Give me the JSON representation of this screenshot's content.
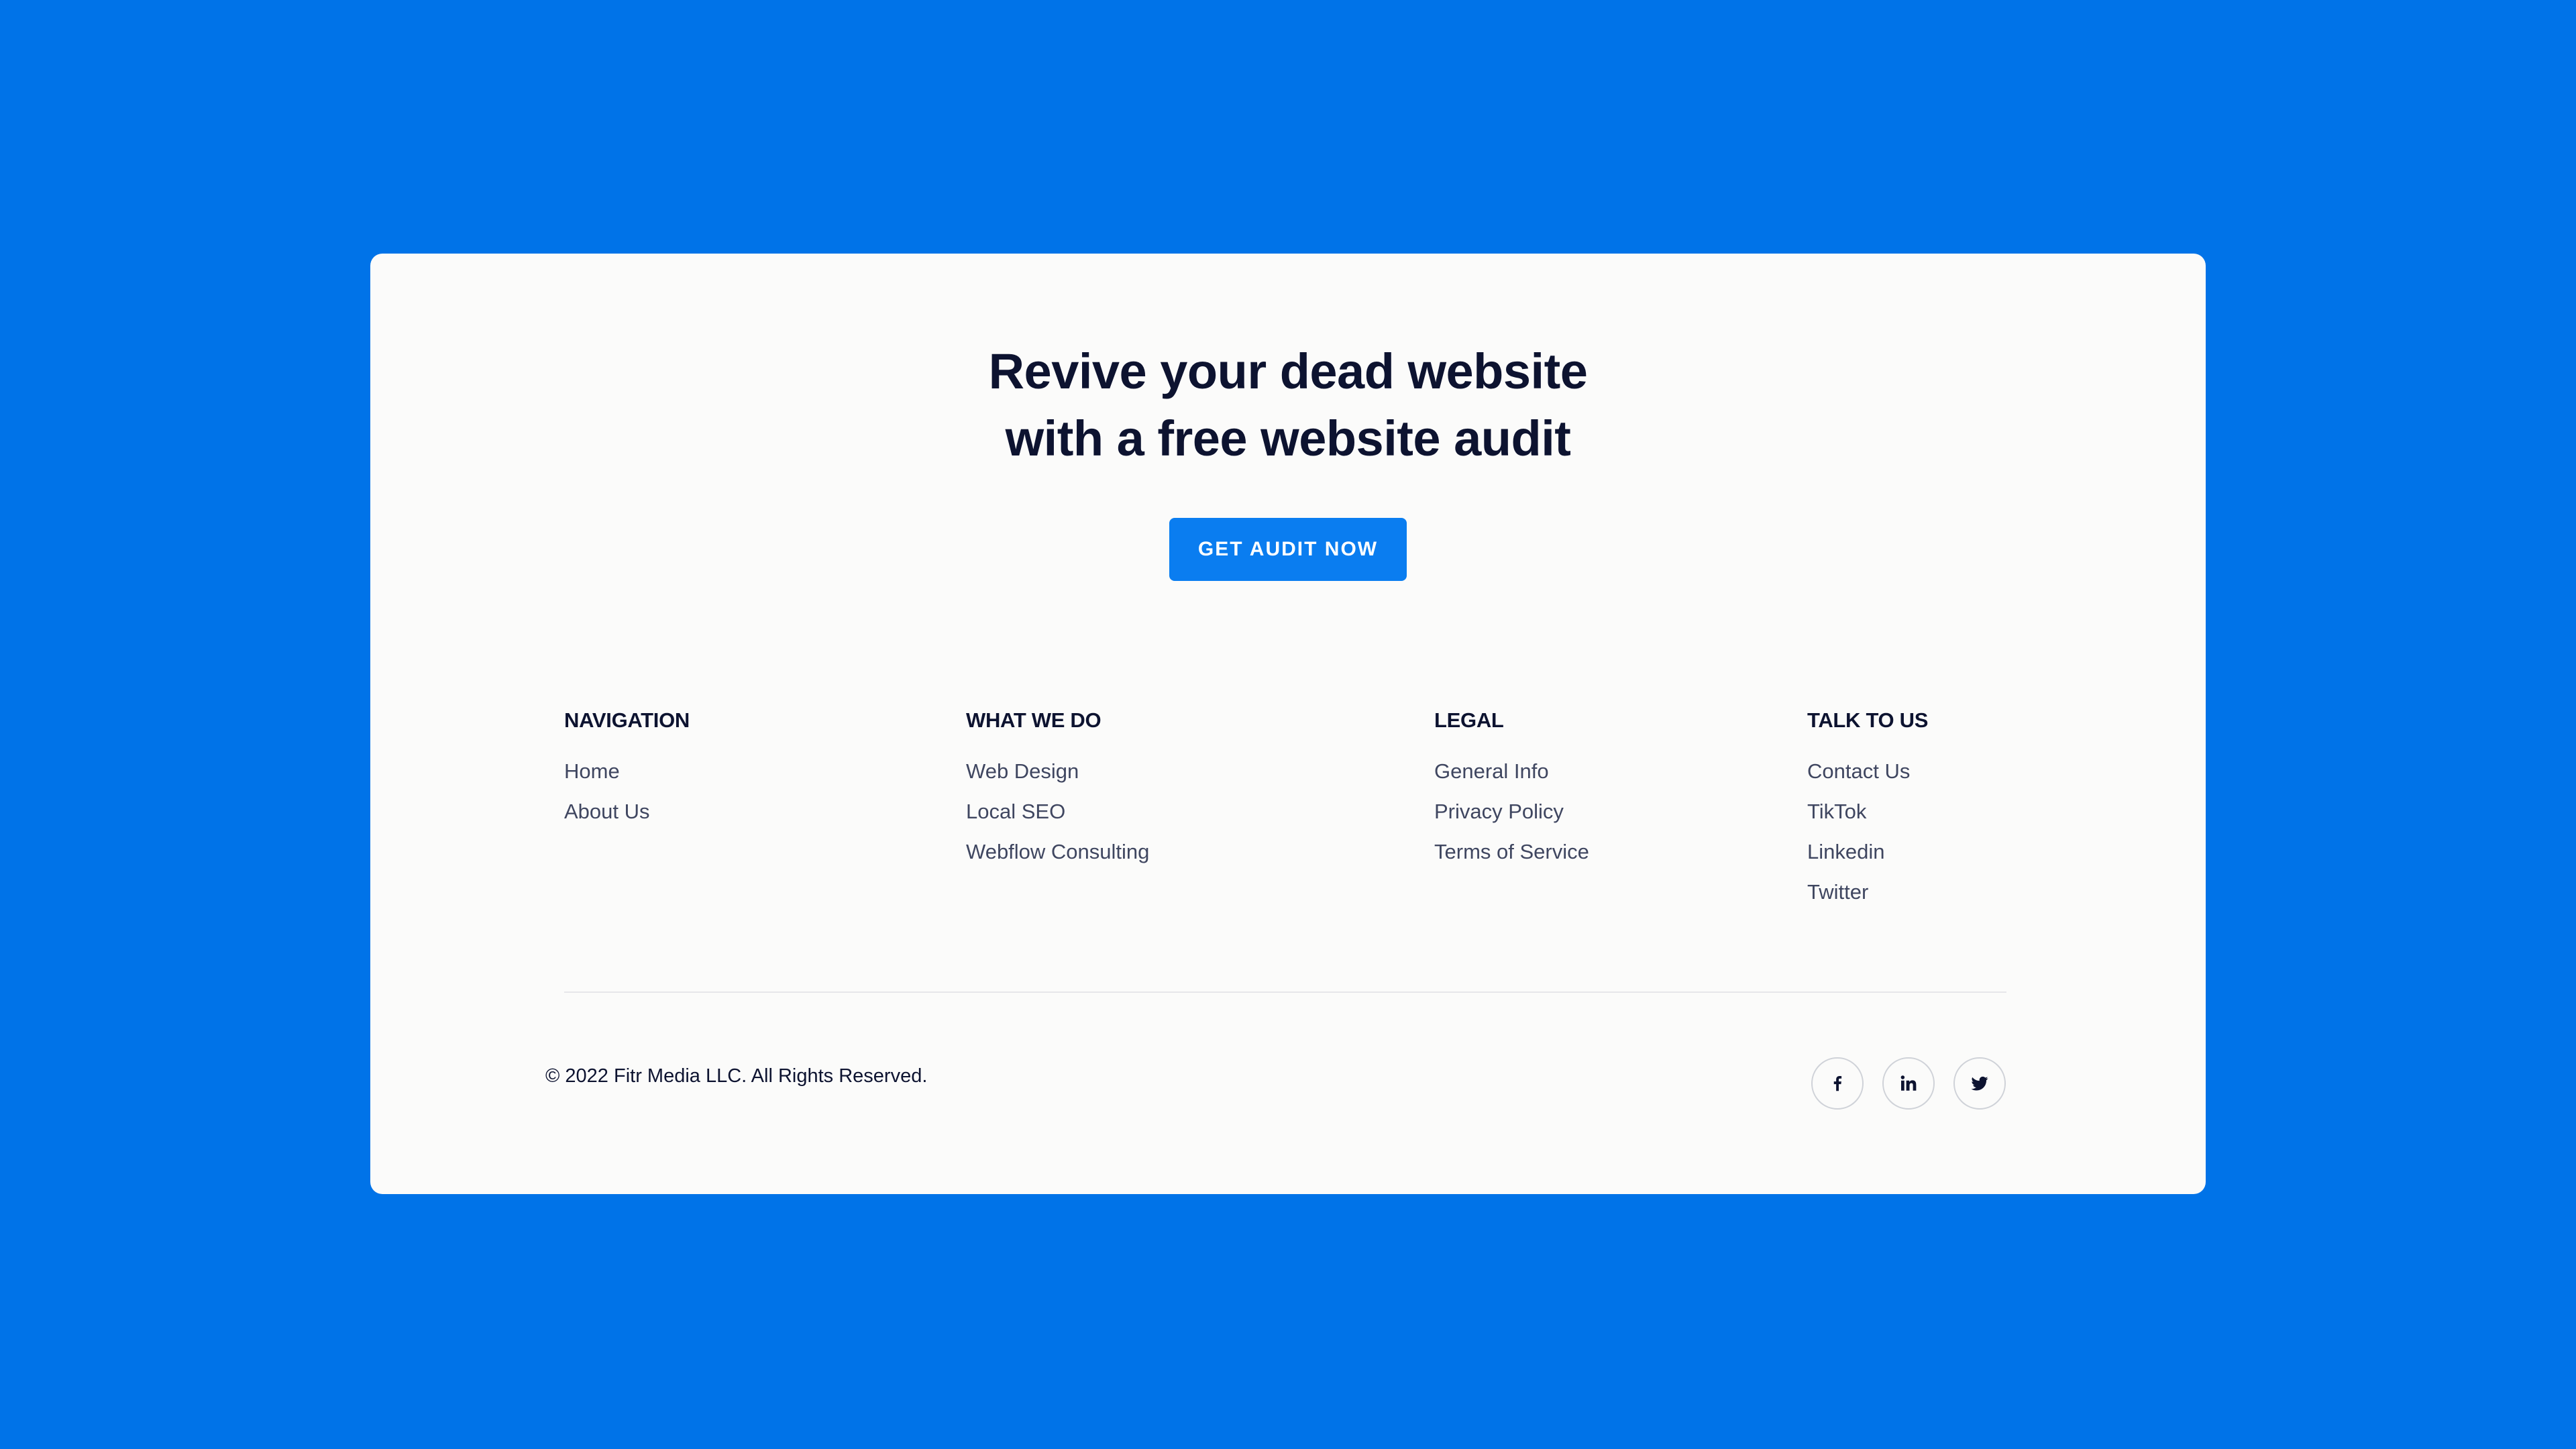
{
  "cta": {
    "heading_line1": "Revive your dead website",
    "heading_line2": "with a free website audit",
    "button_label": "GET AUDIT NOW"
  },
  "footer": {
    "columns": [
      {
        "heading": "NAVIGATION",
        "links": [
          "Home",
          "About Us"
        ]
      },
      {
        "heading": "WHAT WE DO",
        "links": [
          "Web Design",
          "Local SEO",
          "Webflow Consulting"
        ]
      },
      {
        "heading": "LEGAL",
        "links": [
          "General Info",
          "Privacy Policy",
          "Terms of Service"
        ]
      },
      {
        "heading": "TALK TO US",
        "links": [
          "Contact Us",
          "TikTok",
          "Linkedin",
          "Twitter"
        ]
      }
    ],
    "copyright": "© 2022 Fitr Media LLC. All Rights Reserved.",
    "social": [
      {
        "icon": "facebook-icon"
      },
      {
        "icon": "linkedin-icon"
      },
      {
        "icon": "twitter-icon"
      }
    ]
  },
  "colors": {
    "page_background": "#0073e8",
    "card_background": "#fbfbfa",
    "button_background": "#0a7df0",
    "heading_text": "#0d1330",
    "link_text": "#3f4660",
    "divider": "#e6e7ea"
  }
}
